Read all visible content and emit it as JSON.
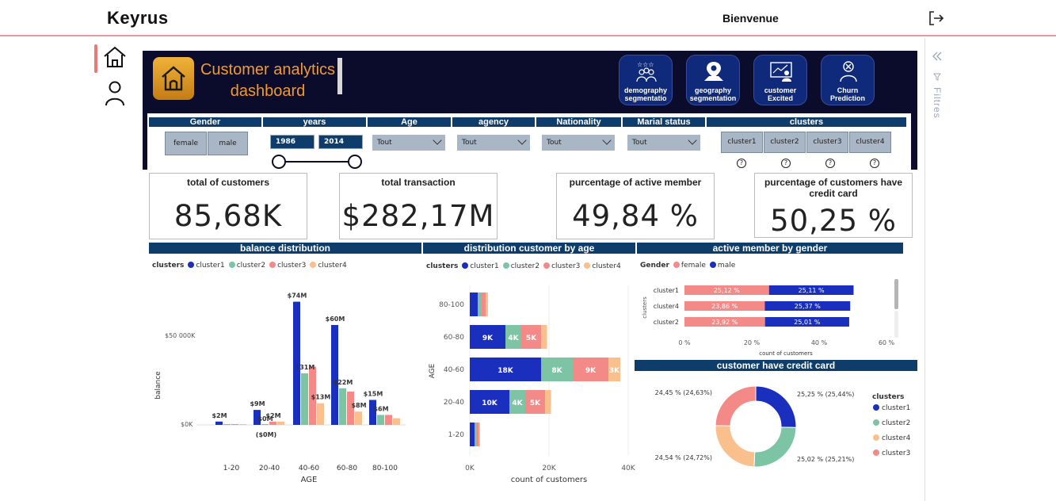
{
  "app": {
    "brand": "Keyrus",
    "welcome": "Bienvenue",
    "filters_label": "Filtres"
  },
  "dashboard": {
    "title_line1": "Customer analytics",
    "title_line2": "dashboard",
    "nav_tiles": [
      {
        "label_line1": "demography",
        "label_line2": "segmentatio",
        "icon": "people-stars-icon"
      },
      {
        "label_line1": "geography",
        "label_line2": "segmentation",
        "icon": "map-pin-icon"
      },
      {
        "label_line1": "customer",
        "label_line2": "Excited",
        "icon": "customer-screen-icon"
      },
      {
        "label_line1": "Churn",
        "label_line2": "Prediction",
        "icon": "churn-user-icon"
      }
    ]
  },
  "slicers": {
    "gender": {
      "label": "Gender",
      "options": [
        "female",
        "male"
      ]
    },
    "years": {
      "label": "years",
      "from": "1986",
      "to": "2014"
    },
    "age": {
      "label": "Age",
      "value": "Tout"
    },
    "agency": {
      "label": "agency",
      "value": "Tout"
    },
    "nationality": {
      "label": "Nationality",
      "value": "Tout"
    },
    "marital": {
      "label": "Marial status",
      "value": "Tout"
    },
    "clusters": {
      "label": "clusters",
      "options": [
        "cluster1",
        "cluster2",
        "cluster3",
        "cluster4"
      ],
      "help": "?"
    }
  },
  "kpis": [
    {
      "label": "total of customers",
      "value": "85,68K"
    },
    {
      "label": "total transaction",
      "value": "$282,17M"
    },
    {
      "label": "purcentage of active member",
      "value": "49,84 %"
    },
    {
      "label": "purcentage of customers have credit card",
      "value": "50,25 %"
    }
  ],
  "colors": {
    "cluster1": "#1a2fbd",
    "cluster2": "#7cc4a4",
    "cluster3": "#f48a88",
    "cluster4": "#f9c08e",
    "navy": "#0f3d6b",
    "female": "#f48a88",
    "male": "#1a2fbd"
  },
  "legend": {
    "title": "clusters",
    "items": [
      "cluster1",
      "cluster2",
      "cluster3",
      "cluster4"
    ]
  },
  "charts": {
    "balance": {
      "title": "balance distribution",
      "ylabel": "balance",
      "xlabel": "AGE",
      "ytick_labels": [
        "$50 000K",
        "$0K"
      ],
      "extra_label": "($0M)"
    },
    "age": {
      "title": "distribution customer by age",
      "ylabel": "AGE",
      "xlabel": "count of customers",
      "xtick_labels": [
        "0K",
        "20K",
        "40K"
      ]
    },
    "gender": {
      "title": "active member by gender",
      "legend_title": "Gender",
      "legend_items": [
        "female",
        "male"
      ],
      "ylabel": "clusters",
      "xlabel": "count of customers",
      "xtick_labels": [
        "0 %",
        "20 %",
        "40 %",
        "60 %"
      ]
    },
    "credit": {
      "title": "customer have credit card",
      "legend_title": "clusters",
      "legend_items": [
        "cluster1",
        "cluster2",
        "cluster4",
        "cluster3"
      ]
    }
  },
  "chart_data": [
    {
      "type": "bar",
      "title": "balance distribution",
      "xlabel": "AGE",
      "ylabel": "balance",
      "categories": [
        "1-20",
        "20-40",
        "40-60",
        "60-80",
        "80-100"
      ],
      "series": [
        {
          "name": "cluster1",
          "values": [
            2,
            9,
            74,
            60,
            15
          ]
        },
        {
          "name": "cluster2",
          "values": [
            0.5,
            0,
            31,
            22,
            6
          ]
        },
        {
          "name": "cluster3",
          "values": [
            0.5,
            2,
            35,
            20,
            6
          ]
        },
        {
          "name": "cluster4",
          "values": [
            0.5,
            2,
            13,
            8,
            4
          ]
        }
      ],
      "data_labels": [
        {
          "category": "1-20",
          "series": "cluster1",
          "text": "$2M"
        },
        {
          "category": "20-40",
          "series": "cluster1",
          "text": "$9M"
        },
        {
          "category": "20-40",
          "series": "cluster2",
          "text": "$0M"
        },
        {
          "category": "20-40",
          "series": "cluster3",
          "text": "$2M"
        },
        {
          "category": "40-60",
          "series": "cluster1",
          "text": "$74M"
        },
        {
          "category": "40-60",
          "series": "cluster2",
          "text": "$31M"
        },
        {
          "category": "40-60",
          "series": "cluster4",
          "text": "$13M"
        },
        {
          "category": "60-80",
          "series": "cluster1",
          "text": "$60M"
        },
        {
          "category": "60-80",
          "series": "cluster2",
          "text": "$22M"
        },
        {
          "category": "60-80",
          "series": "cluster4",
          "text": "$8M"
        },
        {
          "category": "80-100",
          "series": "cluster1",
          "text": "$15M"
        },
        {
          "category": "80-100",
          "series": "cluster2",
          "text": "$6M"
        }
      ],
      "units": "$M",
      "ylim": [
        0,
        80
      ]
    },
    {
      "type": "bar",
      "orientation": "horizontal",
      "stacked": true,
      "title": "distribution customer by age",
      "xlabel": "count of customers",
      "ylabel": "AGE",
      "categories": [
        "80-100",
        "60-80",
        "40-60",
        "20-40",
        "1-20"
      ],
      "series": [
        {
          "name": "cluster1",
          "values": [
            2,
            9,
            18,
            10,
            1.2
          ]
        },
        {
          "name": "cluster2",
          "values": [
            1,
            4,
            8,
            4,
            0.5
          ]
        },
        {
          "name": "cluster3",
          "values": [
            1,
            5,
            9,
            5,
            0.6
          ]
        },
        {
          "name": "cluster4",
          "values": [
            0.6,
            1.5,
            3,
            1.5,
            0.3
          ]
        }
      ],
      "data_labels": [
        {
          "category": "60-80",
          "series": "cluster1",
          "text": "9K"
        },
        {
          "category": "60-80",
          "series": "cluster2",
          "text": "4K"
        },
        {
          "category": "60-80",
          "series": "cluster3",
          "text": "5K"
        },
        {
          "category": "40-60",
          "series": "cluster1",
          "text": "18K"
        },
        {
          "category": "40-60",
          "series": "cluster2",
          "text": "8K"
        },
        {
          "category": "40-60",
          "series": "cluster3",
          "text": "9K"
        },
        {
          "category": "40-60",
          "series": "cluster4",
          "text": "3K"
        },
        {
          "category": "20-40",
          "series": "cluster1",
          "text": "10K"
        },
        {
          "category": "20-40",
          "series": "cluster2",
          "text": "4K"
        },
        {
          "category": "20-40",
          "series": "cluster3",
          "text": "5K"
        }
      ],
      "units": "K",
      "xlim": [
        0,
        40
      ]
    },
    {
      "type": "bar",
      "orientation": "horizontal",
      "stacked": true,
      "title": "active member by gender",
      "xlabel": "count of customers",
      "ylabel": "clusters",
      "categories": [
        "cluster1",
        "cluster4",
        "cluster2"
      ],
      "series": [
        {
          "name": "female",
          "values": [
            25.12,
            23.86,
            23.92
          ],
          "labels": [
            "25,12 %",
            "23,86 %",
            "23,92 %"
          ]
        },
        {
          "name": "male",
          "values": [
            25.11,
            25.37,
            25.01
          ],
          "labels": [
            "25,11 %",
            "25,37 %",
            "25,01 %"
          ]
        }
      ],
      "units": "%",
      "xlim": [
        0,
        60
      ]
    },
    {
      "type": "pie",
      "donut": true,
      "title": "customer have credit card",
      "slices": [
        {
          "name": "cluster1",
          "value": 25.25,
          "label": "25,25 % (25,44%)"
        },
        {
          "name": "cluster2",
          "value": 25.02,
          "label": "25,02 % (25,21%)"
        },
        {
          "name": "cluster4",
          "value": 24.54,
          "label": "24,54 % (24,72%)"
        },
        {
          "name": "cluster3",
          "value": 24.45,
          "label": "24,45 % (24,63%)"
        }
      ]
    }
  ]
}
